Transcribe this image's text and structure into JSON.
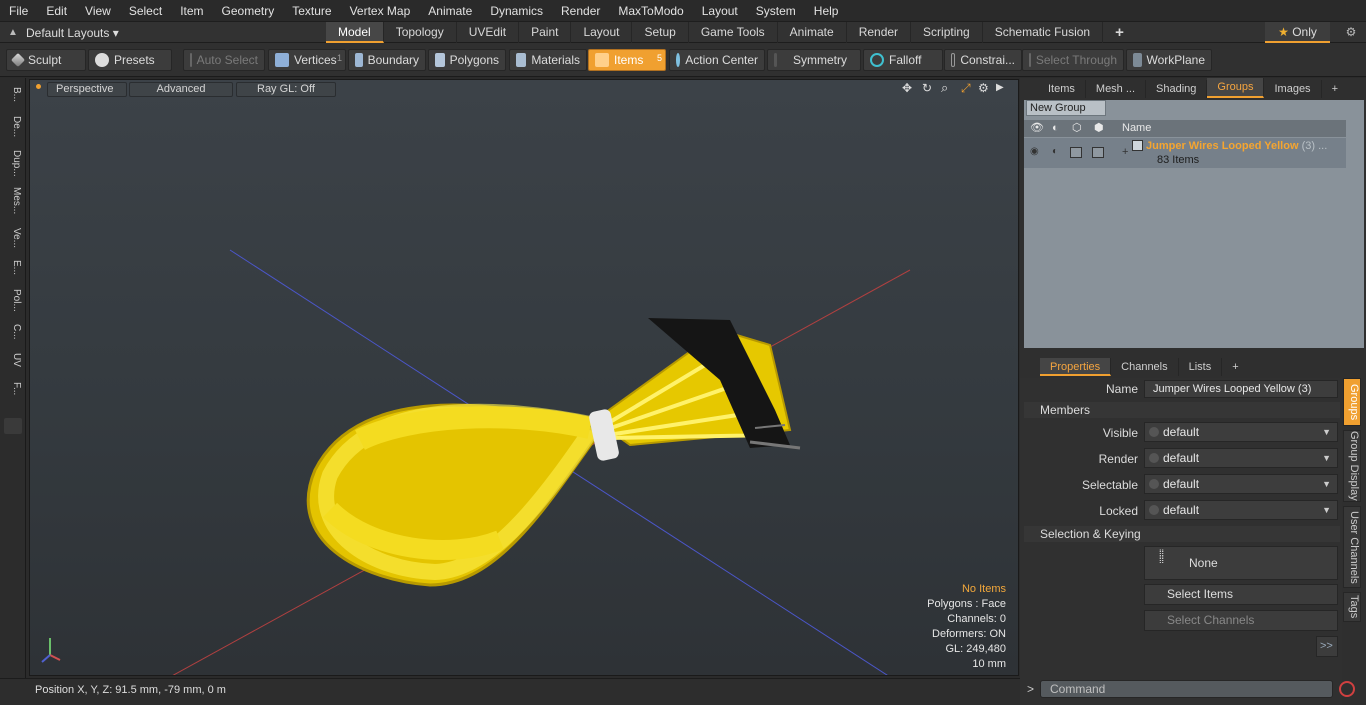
{
  "menu": [
    "File",
    "Edit",
    "View",
    "Select",
    "Item",
    "Geometry",
    "Texture",
    "Vertex Map",
    "Animate",
    "Dynamics",
    "Render",
    "MaxToModo",
    "Layout",
    "System",
    "Help"
  ],
  "layouts": {
    "label": "Default Layouts ▾"
  },
  "mode_tabs": [
    "Model",
    "Topology",
    "UVEdit",
    "Paint",
    "Layout",
    "Setup",
    "Game Tools",
    "Animate",
    "Render",
    "Scripting",
    "Schematic Fusion",
    "+"
  ],
  "only_label": "Only",
  "toolbar": {
    "sculpt": "Sculpt",
    "presets": "Presets",
    "auto_select": "Auto Select",
    "vertices": "Vertices",
    "vertices_count": "1",
    "boundary": "Boundary",
    "polygons": "Polygons",
    "materials": "Materials",
    "items": "Items",
    "items_count": "5",
    "action_center": "Action Center",
    "symmetry": "Symmetry",
    "falloff": "Falloff",
    "constraints": "Constrai...",
    "select_through": "Select Through",
    "workplane": "WorkPlane"
  },
  "left_tabs": [
    "B...",
    "De...",
    "Dup...",
    "Mes...",
    "Ve...",
    "E...",
    "Pol...",
    "C...",
    "UV",
    "F..."
  ],
  "viewport": {
    "perspective": "Perspective",
    "advanced": "Advanced",
    "raygl": "Ray GL: Off",
    "stats": {
      "items": "No Items",
      "polygons": "Polygons : Face",
      "channels": "Channels: 0",
      "deformers": "Deformers: ON",
      "gl": "GL: 249,480",
      "scale": "10 mm"
    }
  },
  "status": {
    "position": "Position X, Y, Z:   91.5 mm, -79 mm, 0 m"
  },
  "right_tabs": [
    "Items",
    "Mesh ...",
    "Shading",
    "Groups",
    "Images",
    "+"
  ],
  "groups": {
    "new_group": "New Group",
    "col_name": "Name",
    "group_name": "Jumper Wires Looped Yellow",
    "group_suffix": "(3) ...",
    "group_count": "83 Items"
  },
  "sub_tabs": [
    "Properties",
    "Channels",
    "Lists",
    "+"
  ],
  "properties": {
    "name_label": "Name",
    "name_value": "Jumper Wires Looped Yellow (3)",
    "members": "Members",
    "visible_label": "Visible",
    "visible": "default",
    "render_label": "Render",
    "render": "default",
    "selectable_label": "Selectable",
    "selectable": "default",
    "locked_label": "Locked",
    "locked": "default",
    "sel_keying": "Selection & Keying",
    "none": "None",
    "select_items": "Select Items",
    "select_channels": "Select Channels",
    "more": ">>"
  },
  "vertical_tabs": [
    "Groups",
    "Group Display",
    "User Channels",
    "Tags"
  ],
  "command": {
    "prompt": ">",
    "placeholder": "Command"
  }
}
